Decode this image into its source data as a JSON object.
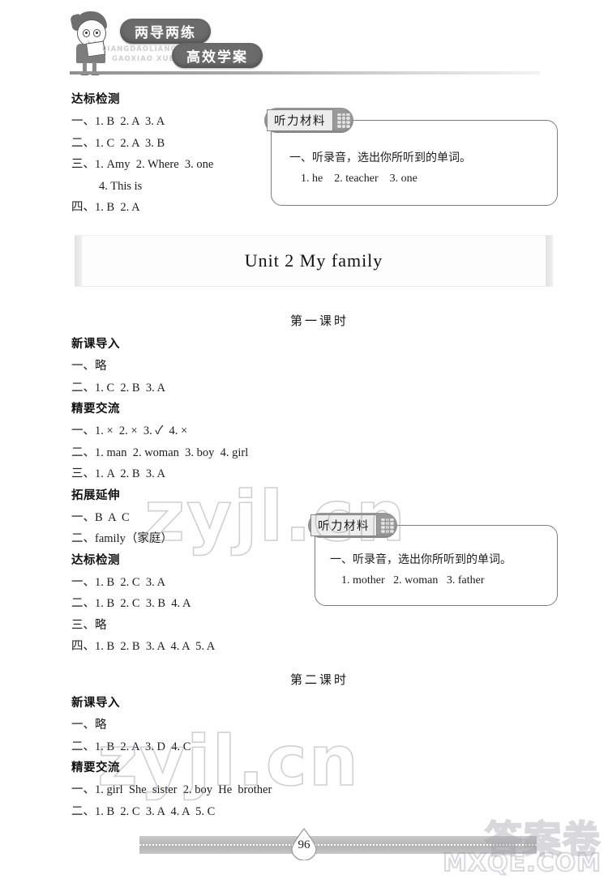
{
  "header": {
    "logo_pill_1": "两导两练",
    "logo_pill_2": "高效学案",
    "pinyin_1": "LIANGDAOLIANGLIAN",
    "pinyin_2": "GAOXIAO XUEAN"
  },
  "unit1_answers": {
    "section_title": "达标检测",
    "lines": [
      "一、1. B  2. A  3. A",
      "二、1. C  2. A  3. B",
      "三、1. Amy  2. Where  3. one",
      "4. This is",
      "四、1. B  2. A"
    ]
  },
  "listening_1": {
    "tab_label": "听力材料",
    "lines": [
      "一、听录音，选出你所听到的单词。",
      "    1. he    2. teacher    3. one"
    ]
  },
  "unit_banner": {
    "title": "Unit 2  My family"
  },
  "lesson_1": {
    "heading": "第一课时",
    "blocks": [
      {
        "title": "新课导入",
        "lines": [
          "一、略",
          "二、1. C  2. B  3. A"
        ]
      },
      {
        "title": "精要交流",
        "lines": [
          "一、1. ×  2. ×  3. ✓  4. ×",
          "二、1. man  2. woman  3. boy  4. girl",
          "三、1. A  2. B  3. A"
        ]
      },
      {
        "title": "拓展延伸",
        "lines": [
          "一、B  A  C",
          "二、family（家庭）"
        ]
      },
      {
        "title": "达标检测",
        "lines": [
          "一、1. B  2. C  3. A",
          "二、1. B  2. C  3. B  4. A",
          "三、略",
          "四、1. B  2. B  3. A  4. A  5. A"
        ]
      }
    ]
  },
  "listening_2": {
    "tab_label": "听力材料",
    "lines": [
      "一、听录音，选出你所听到的单词。",
      "    1. mother   2. woman   3. father"
    ]
  },
  "lesson_2": {
    "heading": "第二课时",
    "blocks": [
      {
        "title": "新课导入",
        "lines": [
          "一、略",
          "二、1. B  2. A  3. D  4. C"
        ]
      },
      {
        "title": "精要交流",
        "lines": [
          "一、1. girl  She  sister  2. boy  He  brother",
          "二、1. B  2. C  3. A  4. A  5. C"
        ]
      }
    ]
  },
  "footer": {
    "page_number": "96"
  },
  "watermarks": {
    "body_text": "zyjl.cn",
    "corner_cn": "答案卷",
    "corner_en": "MXQE.COM"
  },
  "colors": {
    "pill": "#6b6b6b",
    "band": "#b4b4b4",
    "border": "#7d7d7d"
  }
}
